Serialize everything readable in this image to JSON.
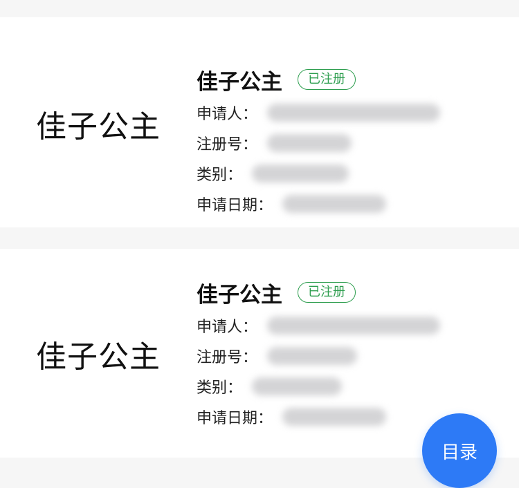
{
  "cards": [
    {
      "logo_text": "佳子公主",
      "title": "佳子公主",
      "status": "已注册",
      "fields": [
        {
          "label": "申请人："
        },
        {
          "label": "注册号："
        },
        {
          "label": "类别："
        },
        {
          "label": "申请日期："
        }
      ]
    },
    {
      "logo_text": "佳子公主",
      "title": "佳子公主",
      "status": "已注册",
      "fields": [
        {
          "label": "申请人："
        },
        {
          "label": "注册号："
        },
        {
          "label": "类别："
        },
        {
          "label": "申请日期："
        }
      ]
    }
  ],
  "fab": {
    "label": "目录"
  },
  "colors": {
    "status_green": "#2e9e4f",
    "fab_blue": "#2d7af6"
  }
}
